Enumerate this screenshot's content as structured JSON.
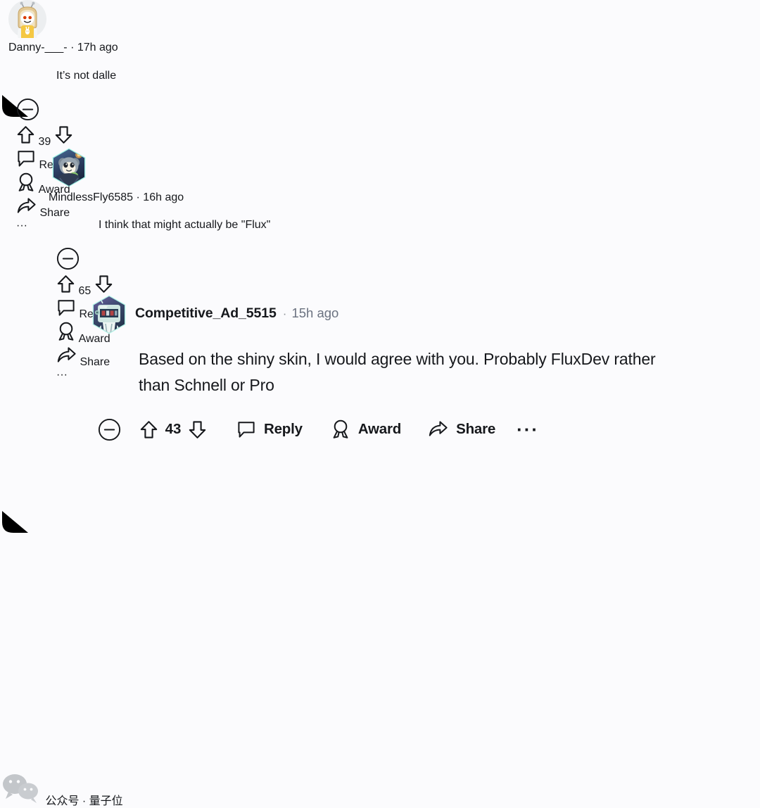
{
  "theme": {
    "background": "#fbfbfd",
    "text_primary": "#16181c",
    "text_muted": "#6b7280",
    "thread_line": "#d8dbde",
    "watermark_color": "#b9bcc0"
  },
  "comments": [
    {
      "id": "comment-1",
      "depth": 0,
      "username": "Danny-___-",
      "separator": "·",
      "timestamp": "17h ago",
      "body": "It’s not dalle",
      "score": "39",
      "actions": {
        "collapse": "collapse-thread",
        "upvote": "upvote",
        "downvote": "downvote",
        "reply": "Reply",
        "award": "Award",
        "share": "Share",
        "more": "···"
      },
      "avatar": {
        "name": "snoo-bread-avatar",
        "type": "circle",
        "bg": "#eceef0",
        "body_color": "#f5c843",
        "head_color": "#e8d3a8",
        "face_color": "#ffffff",
        "eye_color": "#d93a00"
      }
    },
    {
      "id": "comment-2",
      "depth": 1,
      "username": "MindlessFly6585",
      "separator": "·",
      "timestamp": "16h ago",
      "body": "I think that might actually be \"Flux\"",
      "score": "65",
      "actions": {
        "collapse": "collapse-thread",
        "upvote": "upvote",
        "downvote": "downvote",
        "reply": "Reply",
        "award": "Award",
        "share": "Share",
        "more": "···"
      },
      "avatar": {
        "name": "hex-nft-koala-avatar",
        "type": "hexagon",
        "bg_top": "#3f5f8a",
        "bg_bottom": "#1e2c4a",
        "rim": "#7fe3d6",
        "body_color": "#8d9aa6",
        "face_color": "#f7f3e8",
        "accent": "#7fbf6a"
      }
    },
    {
      "id": "comment-3",
      "depth": 2,
      "username": "Competitive_Ad_5515",
      "separator": "·",
      "timestamp": "15h ago",
      "body": "Based on the shiny skin, I would agree with you. Probably FluxDev rather\nthan Schnell or Pro",
      "score": "43",
      "actions": {
        "collapse": "collapse-thread",
        "upvote": "upvote",
        "downvote": "downvote",
        "reply": "Reply",
        "award": "Award",
        "share": "Share",
        "more": "···"
      },
      "avatar": {
        "name": "hex-nft-robot-avatar",
        "type": "hexagon",
        "bg_top": "#59508e",
        "bg_bottom": "#2b3b59",
        "rim": "#9ef0e2",
        "body_color": "#cfe6e2",
        "face_color": "#2a3b50",
        "accent": "#b04a4a"
      }
    }
  ],
  "watermark": {
    "icon": "wechat-icon",
    "text": "公众号 · 量子位"
  }
}
